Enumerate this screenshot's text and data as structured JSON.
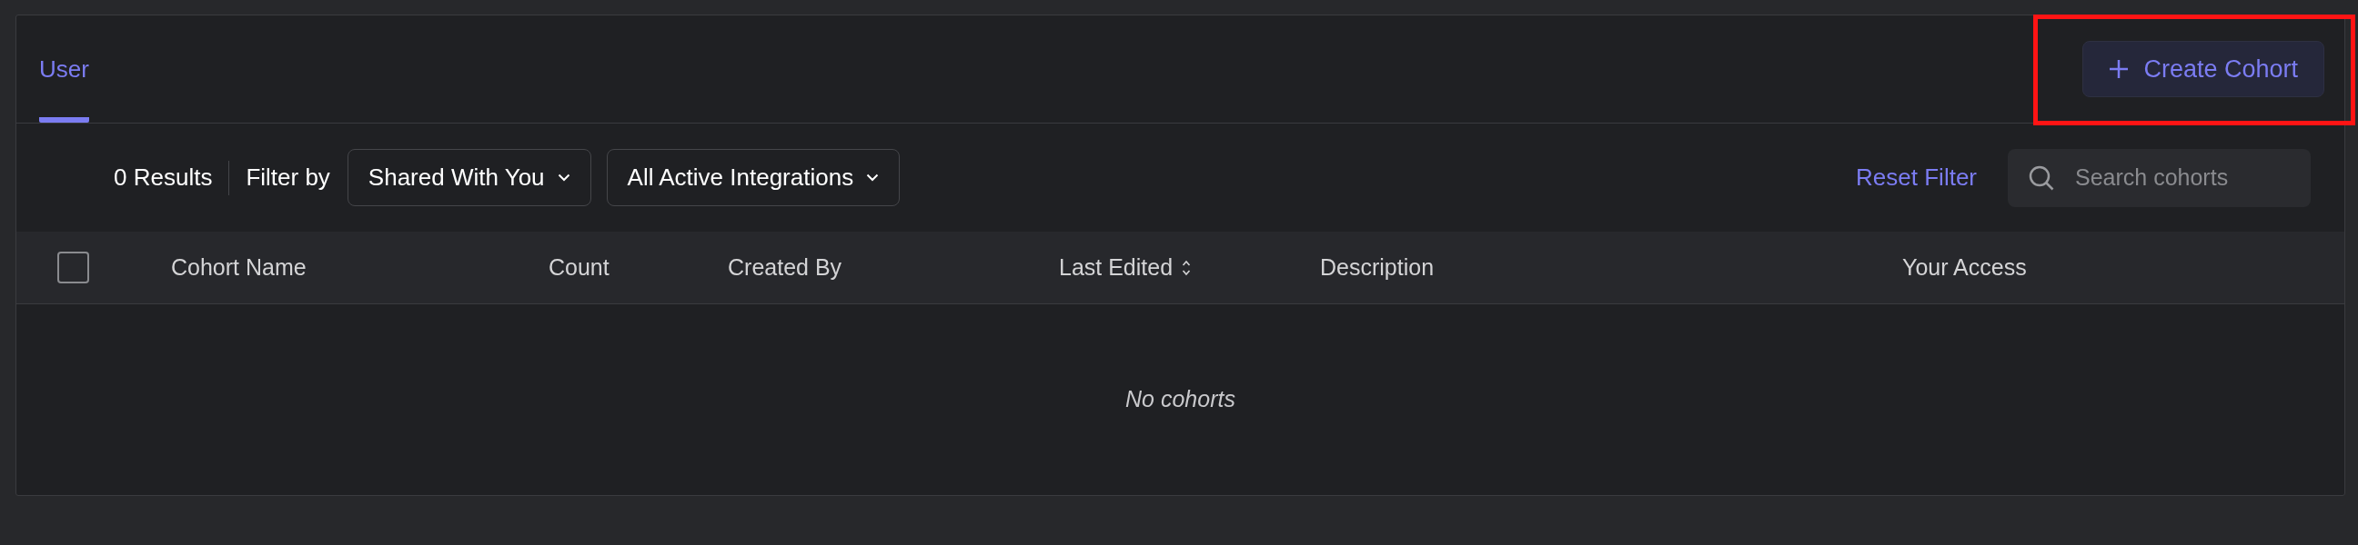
{
  "tabs": [
    {
      "label": "User",
      "selected": true
    }
  ],
  "create_button": {
    "label": "Create Cohort",
    "highlighted": true
  },
  "filter_bar": {
    "results": "0 Results",
    "filter_label": "Filter by",
    "dropdowns": [
      {
        "value": "Shared With You"
      },
      {
        "value": "All Active Integrations"
      }
    ],
    "reset": "Reset Filter",
    "search": {
      "placeholder": "Search cohorts"
    }
  },
  "table": {
    "select_all": {
      "checked": false
    },
    "columns": [
      {
        "label": "Cohort Name",
        "sortable": false
      },
      {
        "label": "Count",
        "sortable": false
      },
      {
        "label": "Created By",
        "sortable": false
      },
      {
        "label": "Last Edited",
        "sortable": true
      },
      {
        "label": "Description",
        "sortable": false
      },
      {
        "label": "Your Access",
        "sortable": false
      }
    ],
    "empty_message": "No cohorts"
  }
}
